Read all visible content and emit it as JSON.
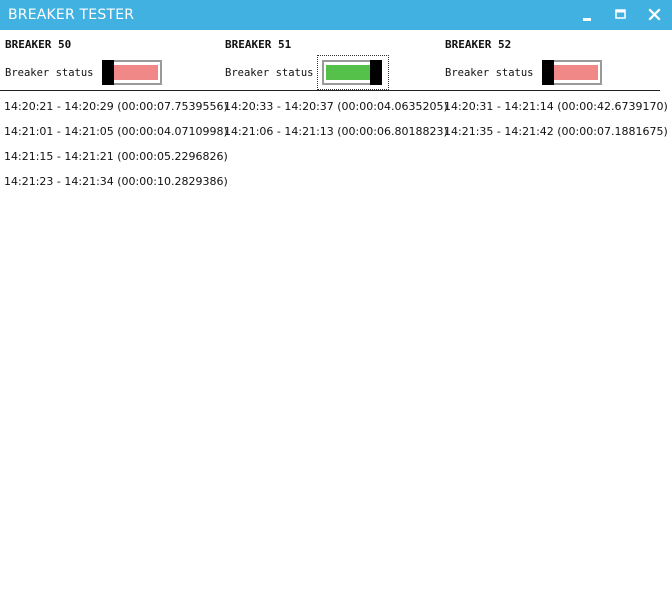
{
  "window": {
    "title": "BREAKER TESTER",
    "titlebar_color": "#41b1e1",
    "icons": [
      "minimize-icon",
      "maximize-icon",
      "close-icon"
    ]
  },
  "breakers": [
    {
      "name": "BREAKER 50",
      "status_label": "Breaker status",
      "state": "off",
      "state_color": "#f08888",
      "log": [
        "14:20:21 - 14:20:29 (00:00:07.7539556)",
        "14:21:01 - 14:21:05 (00:00:04.0710998)",
        "14:21:15 - 14:21:21 (00:00:05.2296826)",
        "14:21:23 - 14:21:34 (00:00:10.2829386)"
      ]
    },
    {
      "name": "BREAKER 51",
      "status_label": "Breaker status",
      "state": "on",
      "state_color": "#55c04a",
      "log": [
        "14:20:33 - 14:20:37 (00:00:04.0635205)",
        "14:21:06 - 14:21:13 (00:00:06.8018823)"
      ]
    },
    {
      "name": "BREAKER 52",
      "status_label": "Breaker status",
      "state": "off",
      "state_color": "#f08888",
      "log": [
        "14:20:31 - 14:21:14 (00:00:42.6739170)",
        "14:21:35 - 14:21:42 (00:00:07.1881675)"
      ]
    }
  ]
}
